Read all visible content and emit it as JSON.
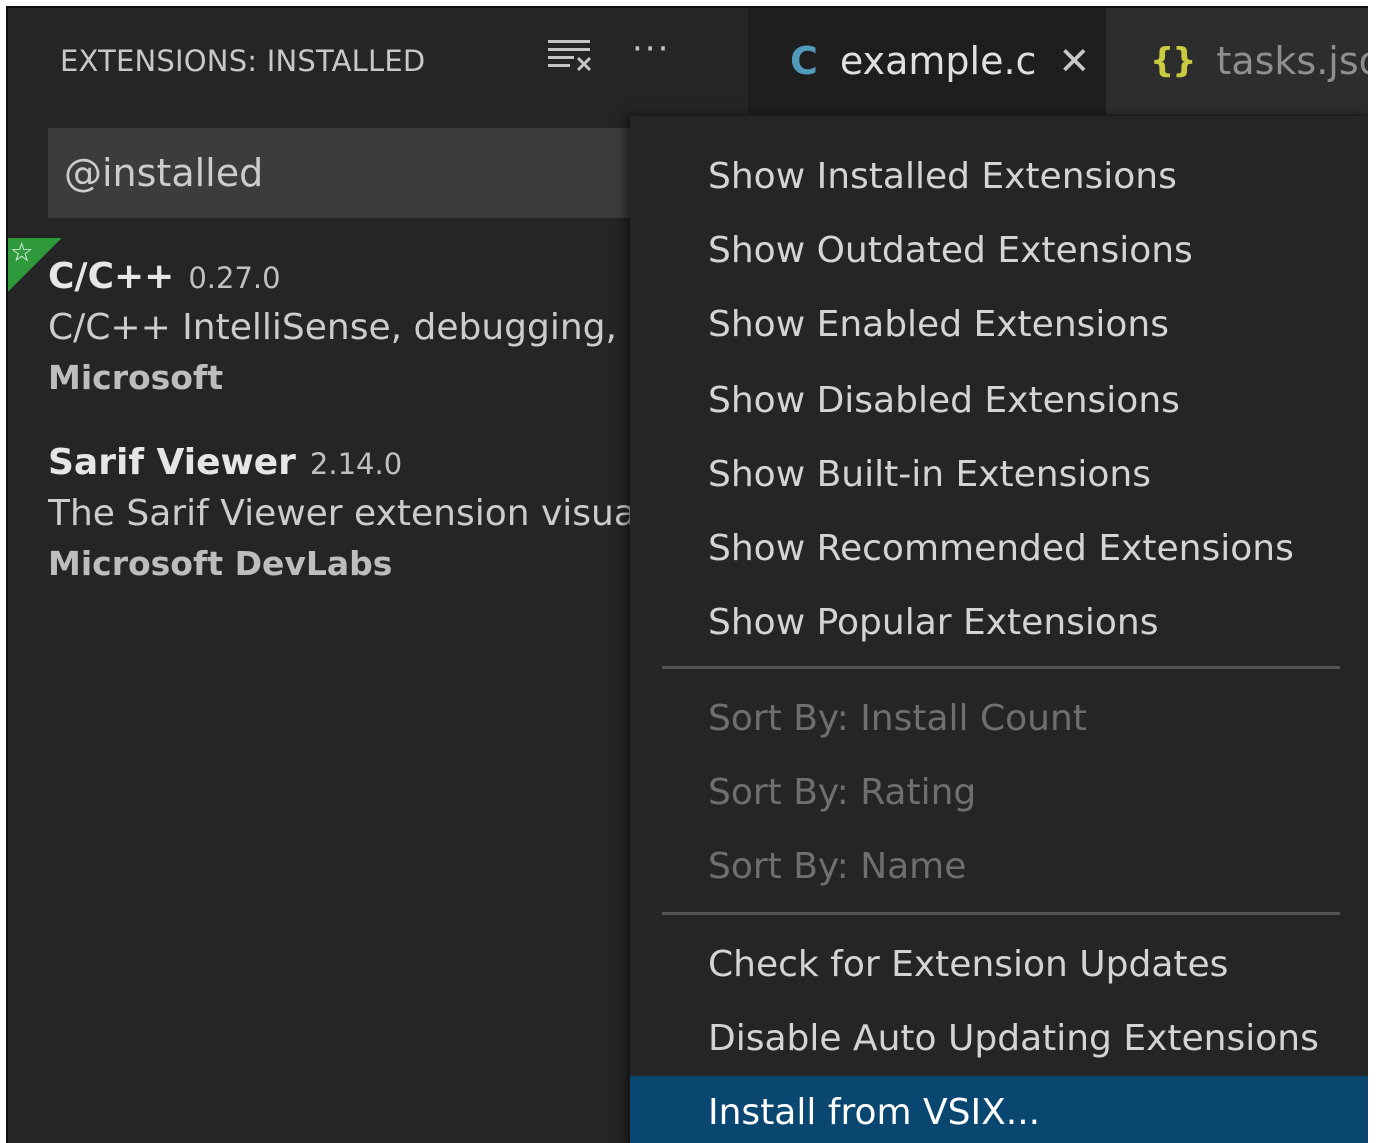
{
  "sidebar": {
    "title": "EXTENSIONS: INSTALLED",
    "actions": {
      "clear_icon": "clear-extensions-input-icon",
      "more_icon": "more-actions-icon",
      "more_label": "···"
    },
    "search": {
      "value": "@installed"
    },
    "extensions": [
      {
        "name": "C/C++",
        "version": "0.27.0",
        "description": "C/C++ IntelliSense, debugging, ar",
        "publisher": "Microsoft",
        "recommended_badge": "star-icon"
      },
      {
        "name": "Sarif Viewer",
        "version": "2.14.0",
        "description": "The Sarif Viewer extension visualiz",
        "publisher": "Microsoft DevLabs"
      }
    ]
  },
  "tabs": [
    {
      "icon_label": "C",
      "label": "example.c",
      "active": true,
      "close_label": "✕"
    },
    {
      "icon_label": "{}",
      "label": "tasks.json",
      "active": false
    }
  ],
  "menu": {
    "groups": [
      [
        "Show Installed Extensions",
        "Show Outdated Extensions",
        "Show Enabled Extensions",
        "Show Disabled Extensions",
        "Show Built-in Extensions",
        "Show Recommended Extensions",
        "Show Popular Extensions"
      ],
      [
        "Sort By: Install Count",
        "Sort By: Rating",
        "Sort By: Name"
      ],
      [
        "Check for Extension Updates",
        "Disable Auto Updating Extensions",
        "Install from VSIX..."
      ]
    ],
    "selected": "Install from VSIX...",
    "disabled_group": 1
  },
  "colors": {
    "background": "#252526",
    "tab_active": "#1e1e1e",
    "tab_inactive": "#2d2d2d",
    "menu_selected": "#094771",
    "c_icon": "#519aba",
    "json_icon": "#cbcb41",
    "recommended_badge": "#2e9a3c"
  }
}
